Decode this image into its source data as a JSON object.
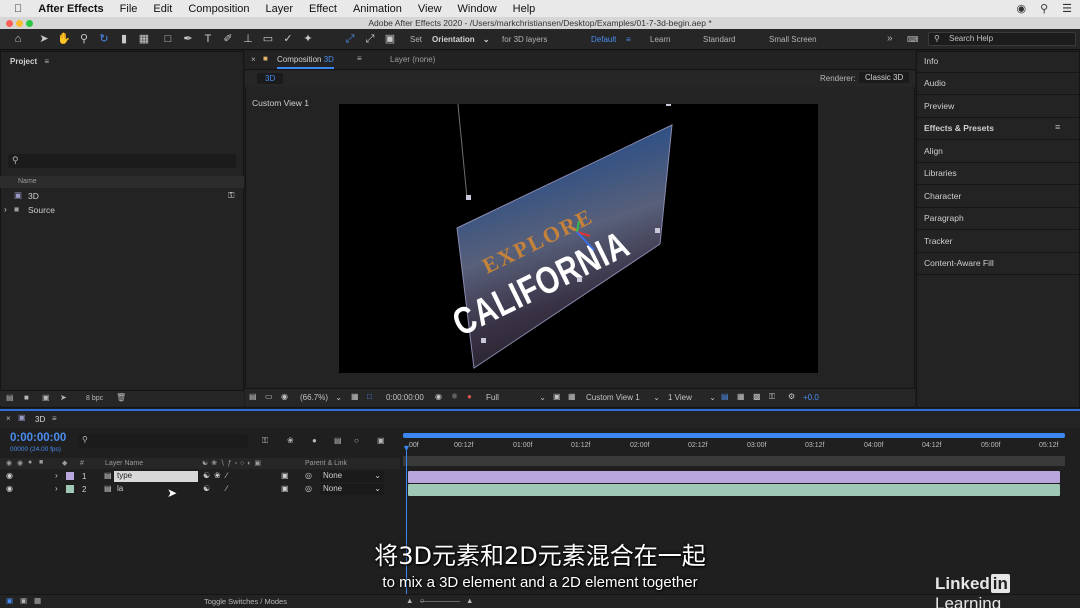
{
  "menubar": {
    "app_name": "After Effects",
    "items": [
      "File",
      "Edit",
      "Composition",
      "Layer",
      "Effect",
      "Animation",
      "View",
      "Window",
      "Help"
    ]
  },
  "titlebar": {
    "title": "Adobe After Effects 2020 - /Users/markchristiansen/Desktop/Examples/01-7-3d-begin.aep *"
  },
  "toolbar": {
    "set_label": "Set",
    "orientation_value": "Orientation",
    "for_3d_layers": "for 3D layers",
    "workspaces": [
      "Default",
      "Learn",
      "Standard",
      "Small Screen"
    ],
    "active_workspace": "Default",
    "search_placeholder": "Search Help"
  },
  "project": {
    "title": "Project",
    "column_name": "Name",
    "items": [
      {
        "name": "3D"
      },
      {
        "name": "Source"
      }
    ],
    "bpc": "8 bpc"
  },
  "composition": {
    "tab_label": "Composition",
    "tab_comp_name": "3D",
    "layer_tab": "Layer (none)",
    "breadcrumb": "3D",
    "renderer_label": "Renderer:",
    "renderer_value": "Classic 3D",
    "view_label": "Custom View 1",
    "artwork": {
      "line1": "EXPLORE",
      "line2": "CALIFORNIA"
    },
    "footer": {
      "zoom": "(66.7%)",
      "timecode": "0:00:00:00",
      "resolution": "Full",
      "view": "Custom View 1",
      "views_count": "1 View",
      "exposure": "+0.0"
    }
  },
  "right_panels": {
    "items": [
      "Info",
      "Audio",
      "Preview",
      "Effects & Presets",
      "Align",
      "Libraries",
      "Character",
      "Paragraph",
      "Tracker",
      "Content-Aware Fill"
    ]
  },
  "timeline": {
    "comp_name": "3D",
    "timecode": "0:00:00:00",
    "frame_info": "00000 (24.00 fps)",
    "col_layer_name": "Layer Name",
    "col_parent": "Parent & Link",
    "layers": [
      {
        "num": "1",
        "name": "type",
        "parent": "None",
        "color": "#b9a6dc"
      },
      {
        "num": "2",
        "name": "la",
        "parent": "None",
        "color": "#9fc9b5"
      }
    ],
    "ruler": [
      "00f",
      "00:12f",
      "01:00f",
      "01:12f",
      "02:00f",
      "02:12f",
      "03:00f",
      "03:12f",
      "04:00f",
      "04:12f",
      "05:00f",
      "05:12f"
    ],
    "toggle_label": "Toggle Switches / Modes"
  },
  "subtitles": {
    "zh": "将3D元素和2D元素混合在一起",
    "en": "to mix a 3D element and a 2D element together"
  },
  "watermark": {
    "brand": "Linked",
    "brand_in": "in",
    "brand_suffix": " Learning"
  }
}
